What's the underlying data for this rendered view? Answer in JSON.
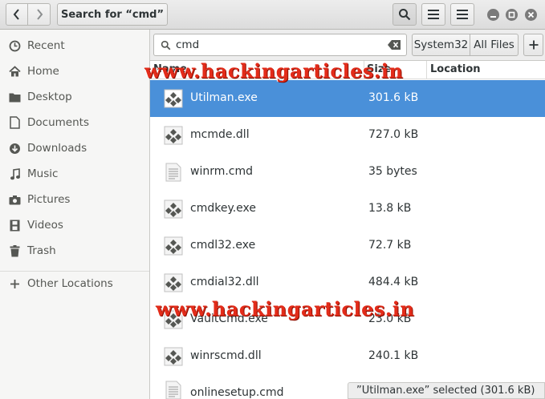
{
  "header": {
    "path_label": "Search for “cmd”"
  },
  "sidebar": {
    "items": [
      {
        "label": "Recent",
        "icon": "clock-icon"
      },
      {
        "label": "Home",
        "icon": "home-icon"
      },
      {
        "label": "Desktop",
        "icon": "folder-icon"
      },
      {
        "label": "Documents",
        "icon": "document-icon"
      },
      {
        "label": "Downloads",
        "icon": "download-icon"
      },
      {
        "label": "Music",
        "icon": "music-note-icon"
      },
      {
        "label": "Pictures",
        "icon": "camera-icon"
      },
      {
        "label": "Videos",
        "icon": "film-icon"
      },
      {
        "label": "Trash",
        "icon": "trash-icon"
      }
    ],
    "other_locations": "Other Locations"
  },
  "search": {
    "query": "cmd",
    "location_current": "System32",
    "location_all": "All Files"
  },
  "columns": {
    "name": "Name",
    "size": "Size",
    "location": "Location"
  },
  "files": [
    {
      "name": "Utilman.exe",
      "size": "301.6 kB",
      "type": "executable",
      "selected": true
    },
    {
      "name": "mcmde.dll",
      "size": "727.0 kB",
      "type": "executable"
    },
    {
      "name": "winrm.cmd",
      "size": "35 bytes",
      "type": "text"
    },
    {
      "name": "cmdkey.exe",
      "size": "13.8 kB",
      "type": "executable"
    },
    {
      "name": "cmdl32.exe",
      "size": "72.7 kB",
      "type": "executable"
    },
    {
      "name": "cmdial32.dll",
      "size": "484.4 kB",
      "type": "executable"
    },
    {
      "name": "VaultCmd.exe",
      "size": "23.0 kB",
      "type": "executable"
    },
    {
      "name": "winrscmd.dll",
      "size": "240.1 kB",
      "type": "executable"
    },
    {
      "name": "onlinesetup.cmd",
      "size": "",
      "type": "text"
    }
  ],
  "watermark": "www.hackingarticles.in",
  "status": "”Utilman.exe” selected  (301.6 kB)",
  "colors": {
    "selection": "#4a90d9",
    "watermark": "#e32c1a"
  }
}
